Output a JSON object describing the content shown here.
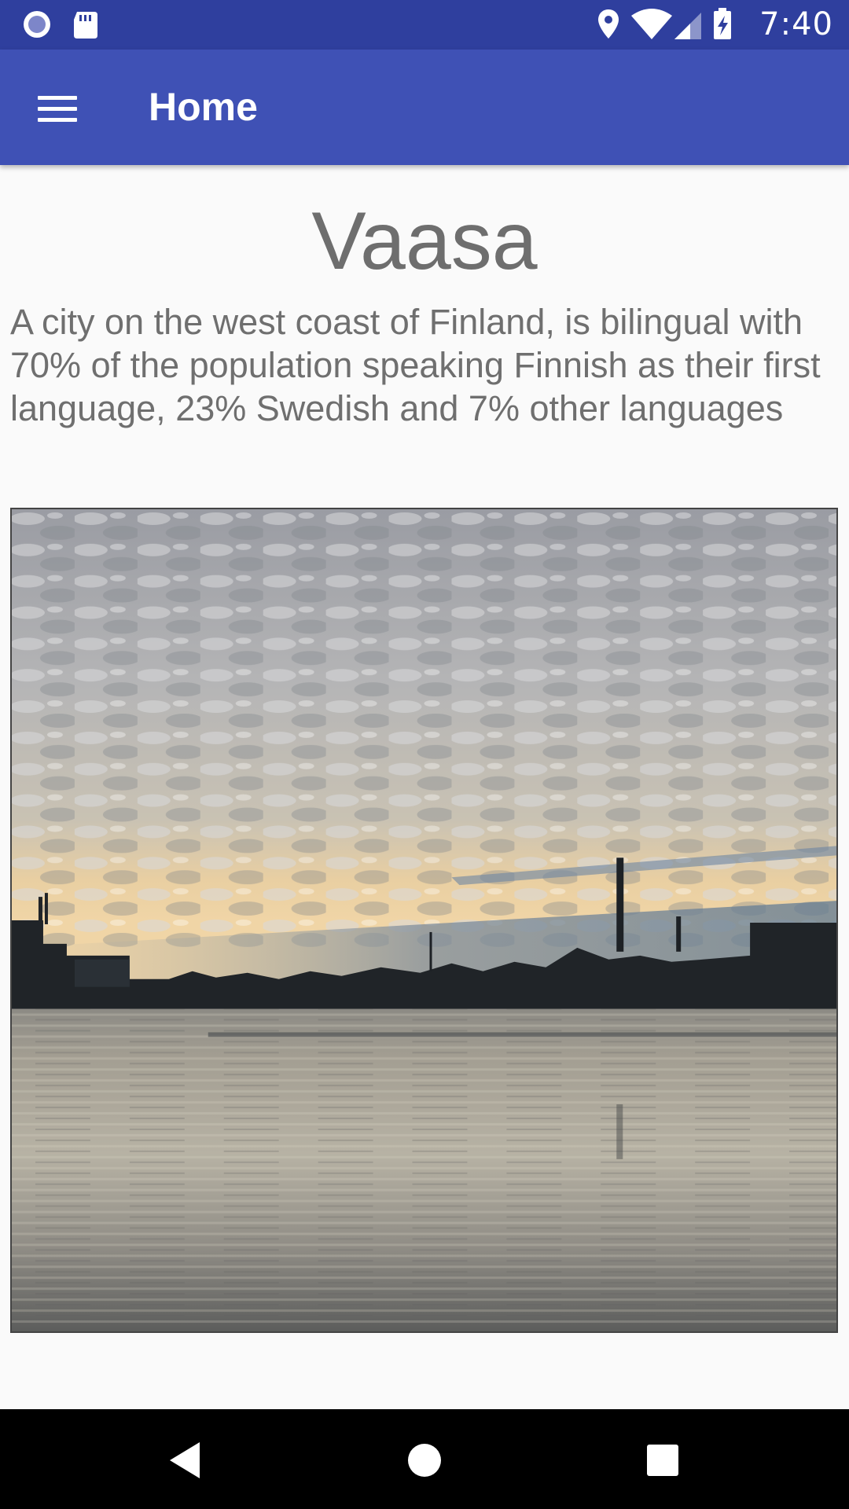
{
  "status_bar": {
    "time": "7:40",
    "icons": [
      "record-icon",
      "sd-card-icon",
      "location-icon",
      "wifi-icon",
      "signal-icon",
      "battery-charging-icon"
    ]
  },
  "app_bar": {
    "title": "Home",
    "menu_icon": "hamburger-menu-icon"
  },
  "content": {
    "title": "Vaasa",
    "description": "A city on the west coast of Finland, is bilingual with 70% of the population speaking Finnish as their first language, 23% Swedish and 7% other languages",
    "image_alt": "Vaasa"
  },
  "nav_bar": {
    "icons": [
      "back-icon",
      "home-icon",
      "recents-icon"
    ]
  },
  "colors": {
    "status_bar": "#2f3f9e",
    "app_bar": "#3f51b5",
    "text": "#6e6e6e",
    "background": "#fafafa"
  }
}
